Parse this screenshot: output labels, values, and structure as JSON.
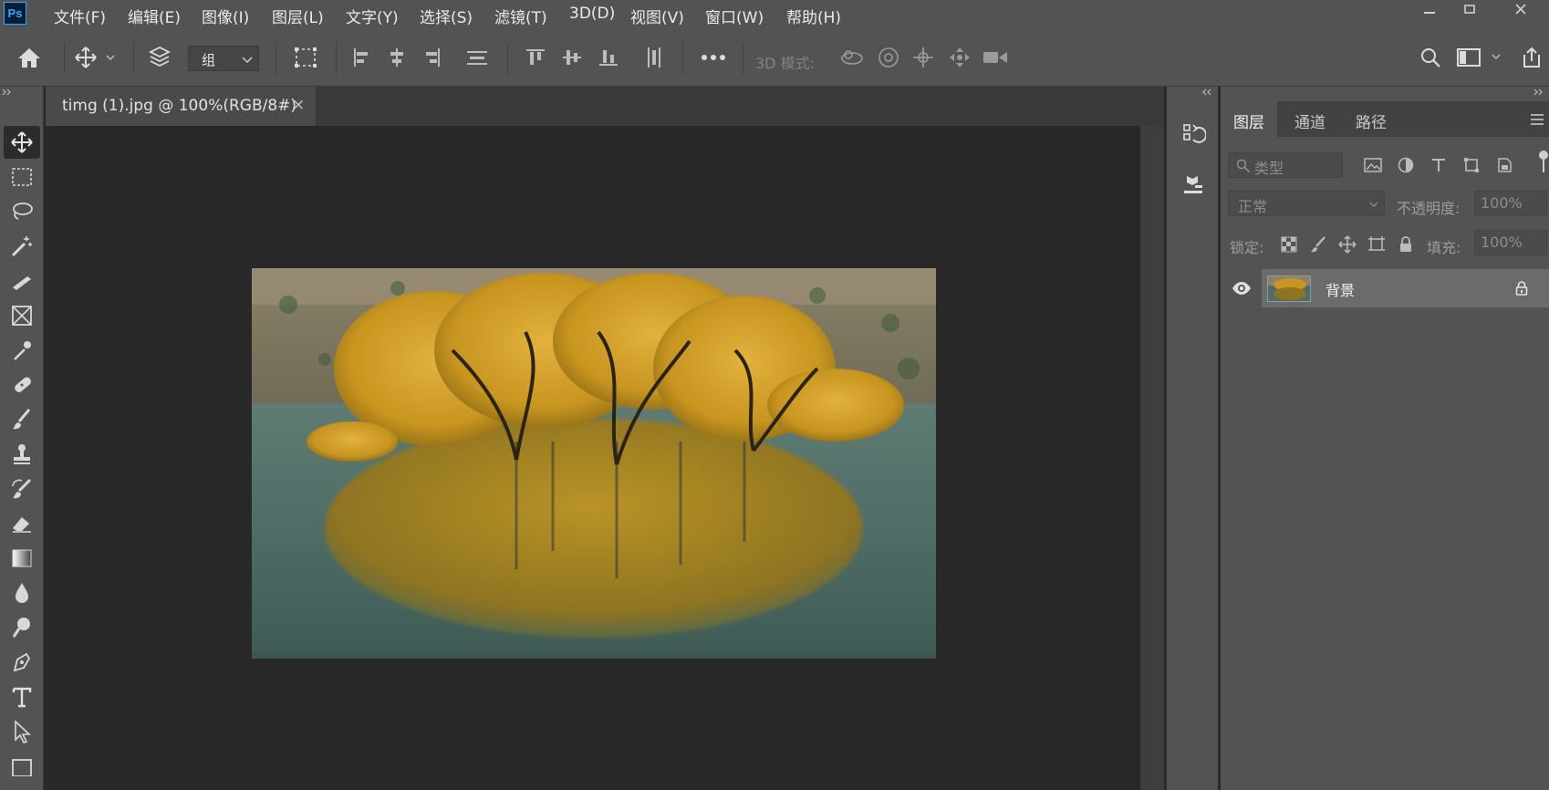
{
  "app": {
    "logo": "Ps"
  },
  "menu": [
    "文件(F)",
    "编辑(E)",
    "图像(I)",
    "图层(L)",
    "文字(Y)",
    "选择(S)",
    "滤镜(T)",
    "3D(D)",
    "视图(V)",
    "窗口(W)",
    "帮助(H)"
  ],
  "options": {
    "group_select": "组",
    "mode_label": "3D 模式:"
  },
  "document": {
    "tab_title": "timg (1).jpg @ 100%(RGB/8#)",
    "close_glyph": "×"
  },
  "panel": {
    "tabs": [
      "图层",
      "通道",
      "路径"
    ],
    "filter_placeholder": "类型",
    "blend_mode": "正常",
    "opacity_label": "不透明度:",
    "opacity_value": "100%",
    "lock_label": "锁定:",
    "fill_label": "填充:",
    "fill_value": "100%",
    "layers": [
      {
        "name": "背景",
        "visible": true,
        "locked": true
      }
    ]
  },
  "colors": {
    "accent": "#31a8ff",
    "ui": "#535353",
    "canvas": "#282828"
  }
}
